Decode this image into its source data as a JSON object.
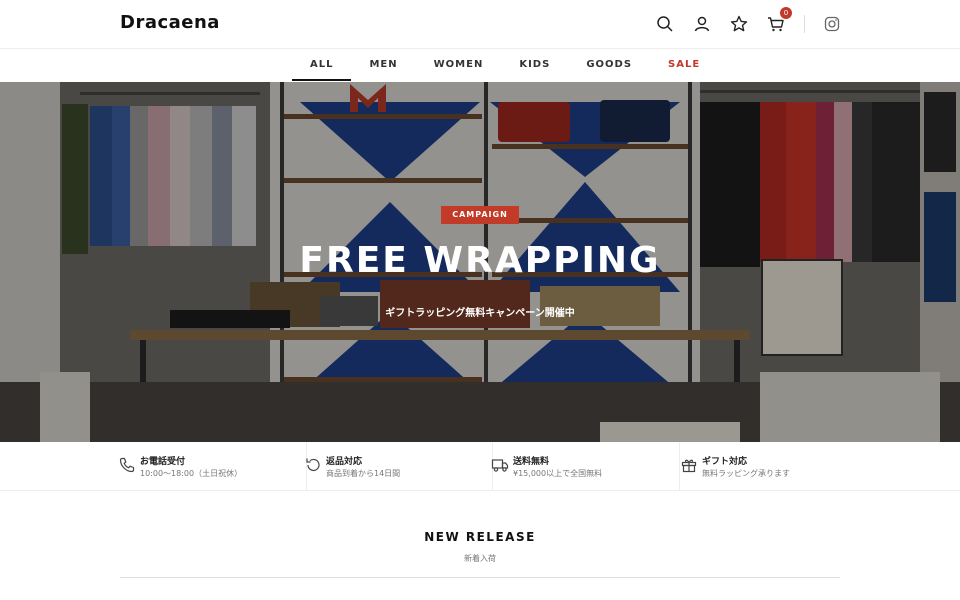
{
  "header": {
    "logo": "Dracaena",
    "icons": [
      "search-icon",
      "user-icon",
      "star-icon",
      "cart-icon",
      "instagram-icon"
    ],
    "cart_count": "0"
  },
  "nav": {
    "items": [
      {
        "label": "ALL",
        "active": true
      },
      {
        "label": "MEN"
      },
      {
        "label": "WOMEN"
      },
      {
        "label": "KIDS"
      },
      {
        "label": "GOODS"
      },
      {
        "label": "SALE",
        "highlight": "#c0392b"
      }
    ]
  },
  "hero": {
    "badge": "CAMPAIGN",
    "title": "FREE WRAPPING",
    "subtitle": "ギフトラッピング無料キャンペーン開催中",
    "accent": "#c23b28"
  },
  "features": [
    {
      "icon": "phone-icon",
      "title": "お電話受付",
      "sub": "10:00〜18:00（土日祝休）"
    },
    {
      "icon": "return-icon",
      "title": "返品対応",
      "sub": "商品到着から14日間"
    },
    {
      "icon": "truck-icon",
      "title": "送料無料",
      "sub": "¥15,000以上で全国無料"
    },
    {
      "icon": "gift-icon",
      "title": "ギフト対応",
      "sub": "無料ラッピング承ります"
    }
  ],
  "section": {
    "title": "NEW RELEASE",
    "subtitle": "新着入荷"
  }
}
